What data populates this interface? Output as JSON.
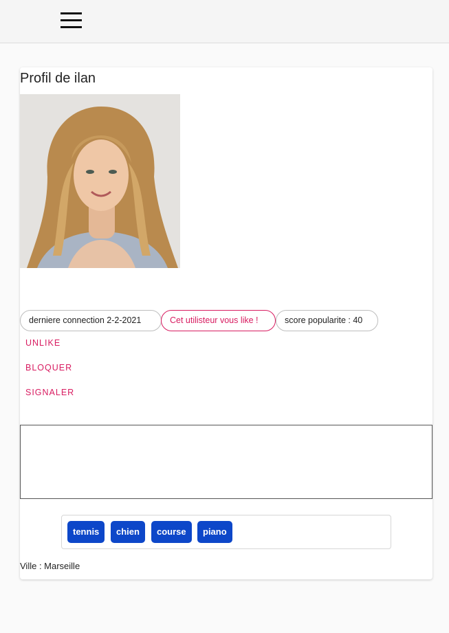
{
  "header": {
    "menu_icon": "hamburger-menu-icon"
  },
  "profile": {
    "title": "Profil de ilan",
    "photo_alt": "Photo de profil",
    "chips": {
      "last_connection": "derniere connection 2-2-2021",
      "liked": "Cet utilisteur vous like !",
      "popularity": "score popularite : 40"
    },
    "actions": {
      "unlike": "UNLIKE",
      "block": "BLOQUER",
      "report": "SIGNALER"
    },
    "bio": "",
    "tags": [
      "tennis",
      "chien",
      "course",
      "piano"
    ],
    "city": "Ville : Marseille"
  },
  "colors": {
    "accent": "#d81b60",
    "tag": "#0d47c9"
  }
}
